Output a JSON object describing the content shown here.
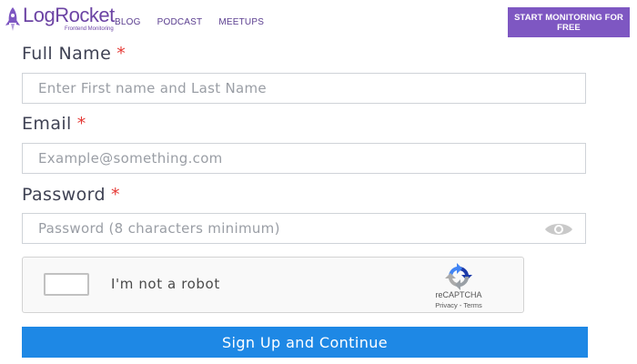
{
  "header": {
    "logo_text": "LogRocket",
    "logo_subtext": "Frontend Monitoring",
    "nav": [
      {
        "label": "BLOG"
      },
      {
        "label": "PODCAST"
      },
      {
        "label": "MEETUPS"
      }
    ],
    "cta_label": "START MONITORING FOR FREE"
  },
  "form": {
    "full_name": {
      "label": "Full Name",
      "required_mark": "*",
      "placeholder": "Enter First name and Last Name",
      "value": ""
    },
    "email": {
      "label": "Email",
      "required_mark": "*",
      "placeholder": "Example@something.com",
      "value": ""
    },
    "password": {
      "label": "Password",
      "required_mark": "*",
      "placeholder": "Password (8 characters minimum)",
      "value": "",
      "toggle_icon": "eye-icon"
    },
    "captcha": {
      "label": "I'm not a robot",
      "brand": "reCAPTCHA",
      "privacy": "Privacy",
      "separator": "-",
      "terms": "Terms",
      "checked": false
    },
    "submit_label": "Sign Up and Continue"
  },
  "colors": {
    "brand_purple": "#7e57c2",
    "primary_blue": "#1e88e5",
    "required_red": "#e53935"
  }
}
